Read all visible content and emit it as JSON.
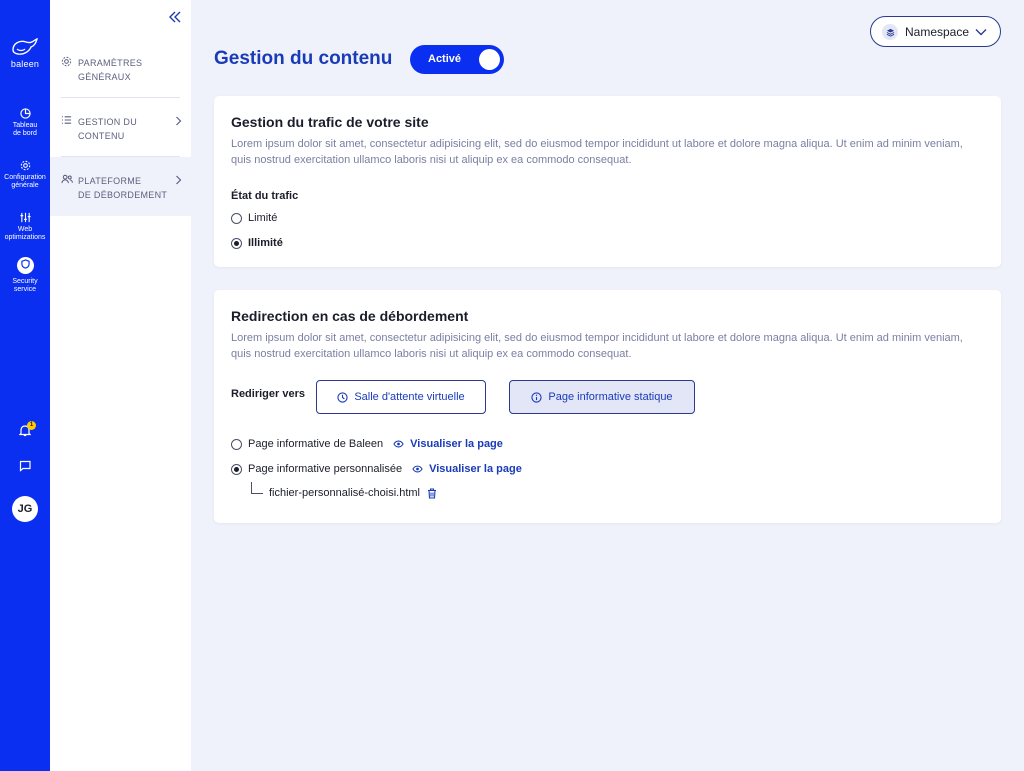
{
  "brand": {
    "logo_text": "baleen"
  },
  "rail": {
    "items": [
      {
        "label_line1": "Tableau",
        "label_line2": "de bord",
        "icon": "pie-chart-icon"
      },
      {
        "label_line1": "Configuration",
        "label_line2": "générale",
        "icon": "gear-icon"
      },
      {
        "label_line1": "Web",
        "label_line2": "optimizations",
        "icon": "sliders-icon"
      },
      {
        "label_line1": "Security",
        "label_line2": "service",
        "icon": "shield-icon"
      }
    ],
    "notifications_count": "1",
    "avatar_initials": "JG"
  },
  "subnav": {
    "items": [
      {
        "line1": "PARAMÈTRES",
        "line2": "GÉNÉRAUX",
        "icon": "gear-icon"
      },
      {
        "line1": "GESTION DU",
        "line2": "CONTENU",
        "icon": "list-icon"
      },
      {
        "line1": "PLATEFORME",
        "line2": "DE DÉBORDEMENT",
        "icon": "users-icon"
      }
    ]
  },
  "header": {
    "title": "Gestion du contenu",
    "toggle_label": "Activé",
    "namespace_label": "Namespace"
  },
  "traffic_card": {
    "title": "Gestion du trafic de votre site",
    "description": "Lorem ipsum dolor sit amet, consectetur adipisicing elit, sed do eiusmod tempor incididunt ut labore et dolore magna aliqua. Ut enim ad minim veniam, quis nostrud exercitation ullamco laboris nisi ut aliquip ex ea commodo consequat.",
    "field_label": "État du trafic",
    "options": [
      {
        "label": "Limité",
        "selected": false
      },
      {
        "label": "Illimité",
        "selected": true
      }
    ]
  },
  "redirect_card": {
    "title": "Redirection en cas de débordement",
    "description": "Lorem ipsum dolor sit amet, consectetur adipisicing elit, sed do eiusmod tempor incididunt ut labore et dolore magna aliqua. Ut enim ad minim veniam, quis nostrud exercitation ullamco laboris nisi ut aliquip ex ea commodo consequat.",
    "redirect_label": "Rediriger vers",
    "choices": [
      {
        "label": "Salle d'attente virtuelle",
        "icon": "clock-icon",
        "selected": false
      },
      {
        "label": "Page informative statique",
        "icon": "info-icon",
        "selected": true
      }
    ],
    "page_options": [
      {
        "label": "Page informative de Baleen",
        "selected": false,
        "link": "Visualiser la page"
      },
      {
        "label": "Page informative personnalisée",
        "selected": true,
        "link": "Visualiser la page"
      }
    ],
    "file_name": "fichier-personnalisé-choisi.html"
  },
  "colors": {
    "primary": "#0a2ff0",
    "title_blue": "#1a3bb8",
    "background": "#f0f2fb"
  }
}
